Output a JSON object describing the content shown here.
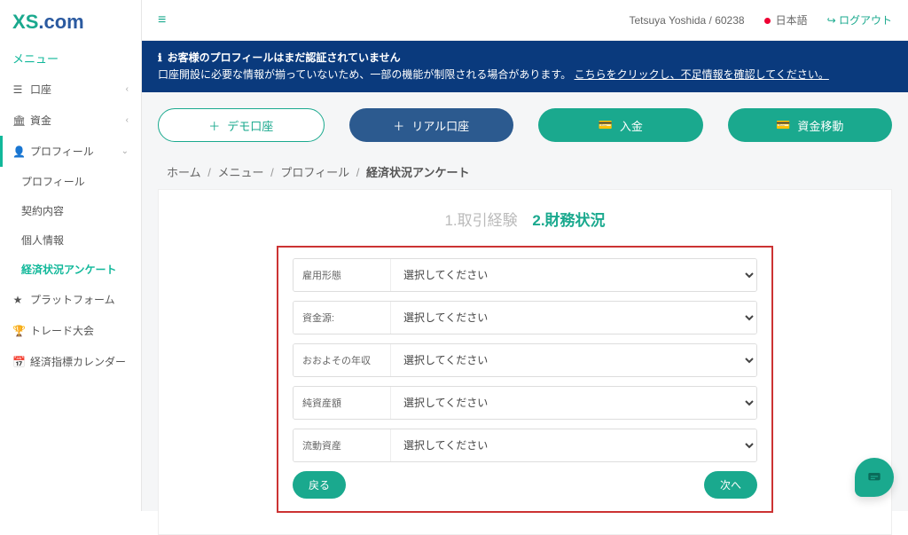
{
  "logo": {
    "x": "X",
    "s": "S",
    "dot": ".",
    "com": "com"
  },
  "menuTitle": "メニュー",
  "nav": {
    "account": "口座",
    "funds": "資金",
    "profile": "プロフィール",
    "profileSub": "プロフィール",
    "contract": "契約内容",
    "personal": "個人情報",
    "survey": "経済状況アンケート",
    "platform": "プラットフォーム",
    "competition": "トレード大会",
    "calendar": "経済指標カレンダー"
  },
  "top": {
    "user": "Tetsuya Yoshida / 60238",
    "lang": "日本語",
    "logout": "ログアウト"
  },
  "alert": {
    "title": "お客様のプロフィールはまだ認証されていません",
    "body": "口座開設に必要な情報が揃っていないため、一部の機能が制限される場合があります。",
    "link": "こちらをクリックし、不足情報を確認してください。"
  },
  "buttons": {
    "demo": "デモ口座",
    "real": "リアル口座",
    "deposit": "入金",
    "transfer": "資金移動"
  },
  "breadcrumb": {
    "home": "ホーム",
    "menu": "メニュー",
    "profile": "プロフィール",
    "current": "経済状況アンケート"
  },
  "steps": {
    "s1n": "1.",
    "s1": "取引経験",
    "s2n": "2.",
    "s2": "財務状況"
  },
  "form": {
    "placeholder": "選択してください",
    "employment": "雇用形態",
    "source": "資金源:",
    "income": "おおよその年収",
    "networth": "純資産額",
    "liquid": "流動資産",
    "back": "戻る",
    "next": "次へ"
  }
}
